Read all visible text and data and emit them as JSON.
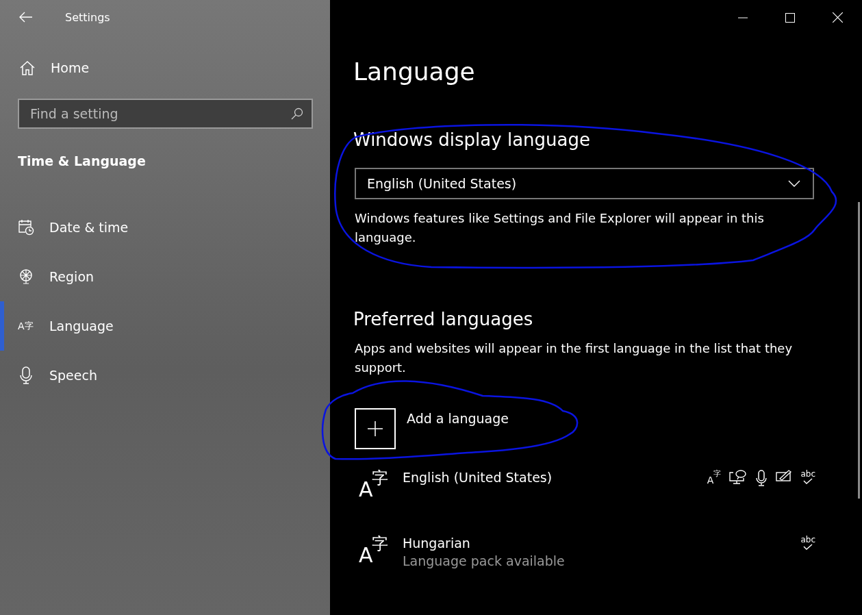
{
  "window": {
    "title": "Settings"
  },
  "sidebar": {
    "home": "Home",
    "search": {
      "placeholder": "Find a setting"
    },
    "section": "Time & Language",
    "items": [
      {
        "label": "Date & time",
        "kind": "calendar",
        "selected": false
      },
      {
        "label": "Region",
        "kind": "globe",
        "selected": false
      },
      {
        "label": "Language",
        "kind": "language",
        "glyphs": [
          "A",
          "字"
        ],
        "selected": true
      },
      {
        "label": "Speech",
        "kind": "microphone",
        "selected": false
      }
    ]
  },
  "page": {
    "title": "Language",
    "display_language": {
      "heading": "Windows display language",
      "value": "English (United States)",
      "description": "Windows features like Settings and File Explorer will appear in this language."
    },
    "preferred": {
      "heading": "Preferred languages",
      "description": "Apps and websites will appear in the first language in the list that they support.",
      "add_button": "Add a language",
      "languages": [
        {
          "name": "English (United States)",
          "glyphs": [
            "A",
            "字"
          ],
          "features": [
            {
              "kind": "display",
              "glyphs": [
                "A",
                "字"
              ]
            },
            {
              "kind": "text-to-speech"
            },
            {
              "kind": "speech"
            },
            {
              "kind": "handwriting"
            },
            {
              "kind": "spelling",
              "text": "abc"
            }
          ]
        },
        {
          "name": "Hungarian",
          "glyphs": [
            "A",
            "字"
          ],
          "status": "Language pack available",
          "features": [
            {
              "kind": "spelling",
              "text": "abc"
            }
          ]
        }
      ]
    }
  }
}
